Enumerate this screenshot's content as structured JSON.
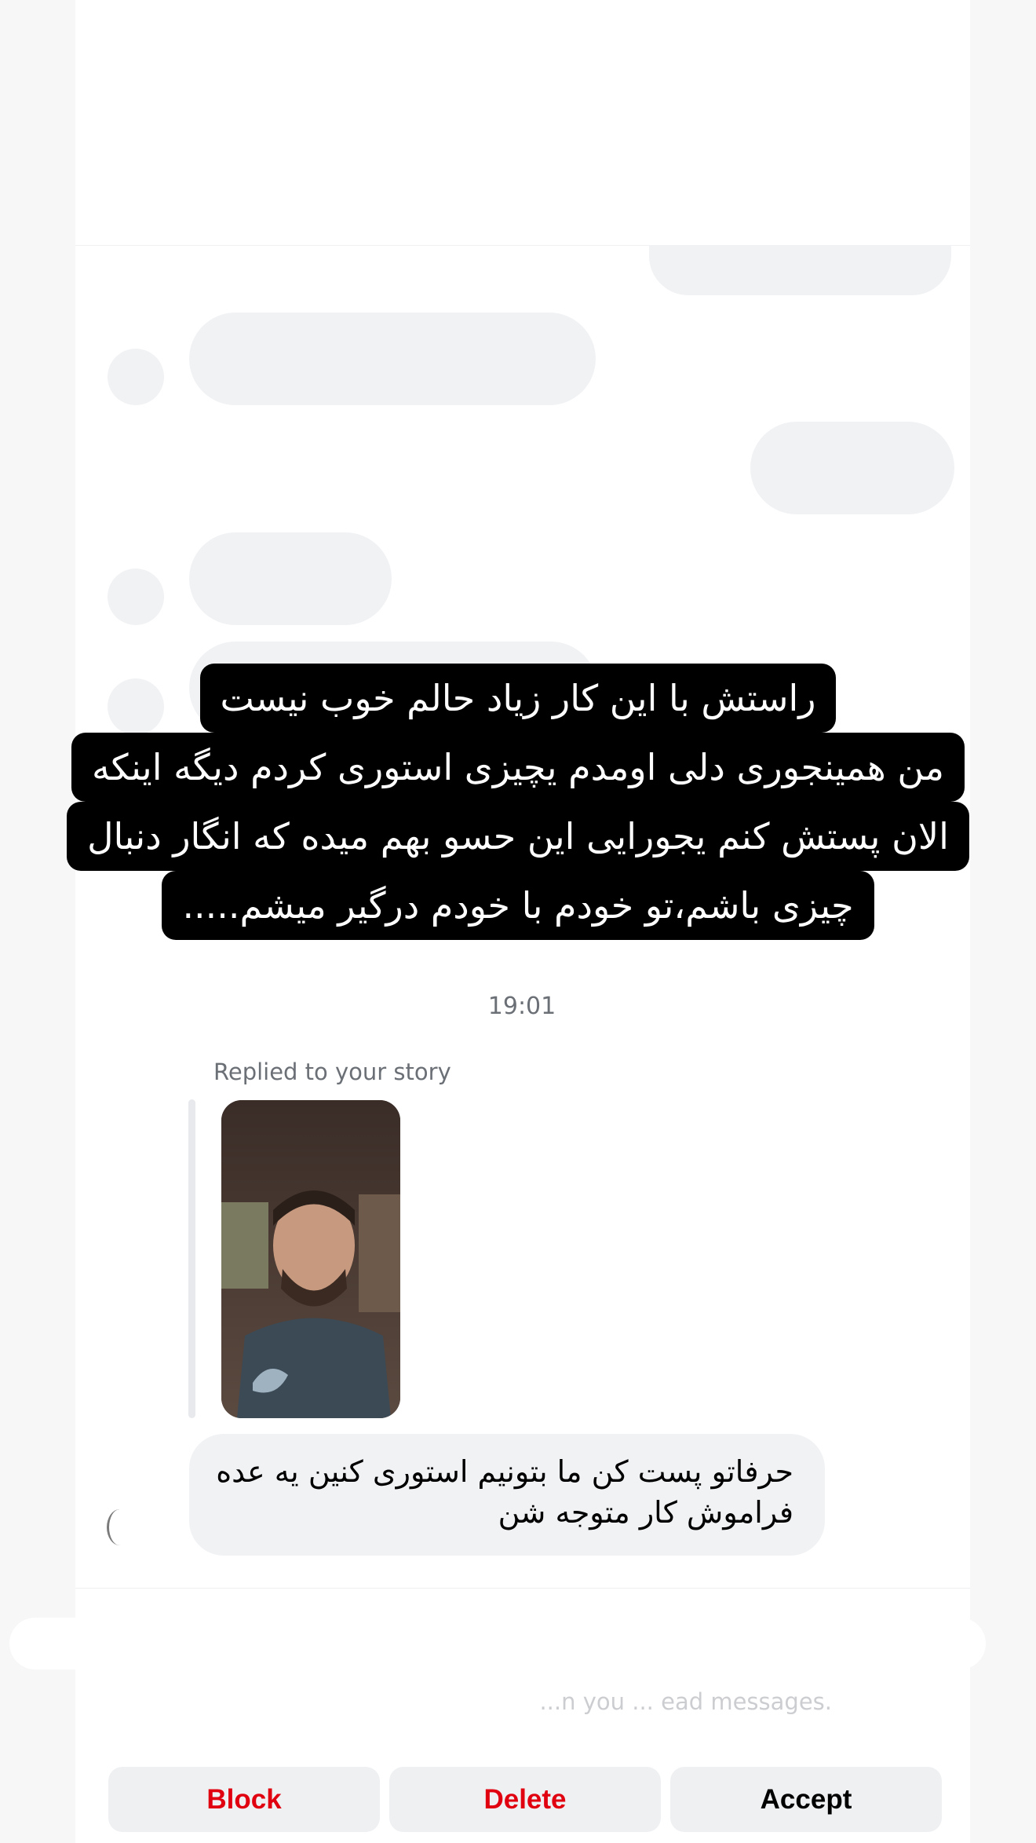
{
  "story_overlay": {
    "lines": [
      "راستش با این کار زیاد حالم خوب نیست",
      "من همینجوری دلی اومدم یچیزی استوری کردم دیگه اینکه",
      "الان پستش کنم یجورایی این حسو بهم میده که انگار دنبال",
      "چیزی باشم،تو خودم با خودم درگیر میشم....."
    ]
  },
  "conversation": {
    "timestamp": "19:01",
    "reply_label": "Replied to your story",
    "message_text": "حرفاتو پست کن ما بتونیم استوری کنین یه عده فراموش کار متوجه شن"
  },
  "request_footer": {
    "note": "...n you ... ead messages."
  },
  "actions": {
    "block": "Block",
    "delete": "Delete",
    "accept": "Accept"
  },
  "colors": {
    "block": "#e0000f",
    "delete": "#e0000f",
    "accept": "#000000",
    "button_bg": "#eff0f2"
  }
}
